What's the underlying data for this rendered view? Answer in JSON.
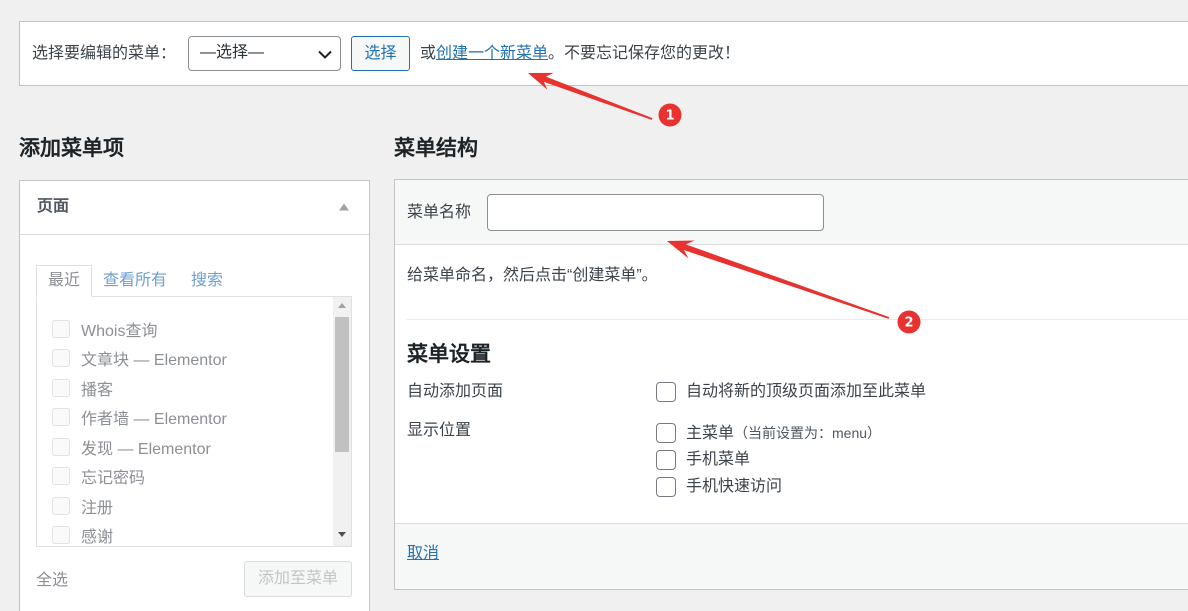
{
  "top_bar": {
    "label": "选择要编辑的菜单：",
    "select_value": "—选择—",
    "select_button": "选择",
    "or_text": "或",
    "create_link": "创建一个新菜单",
    "reminder": "。不要忘记保存您的更改！"
  },
  "add_items": {
    "heading": "添加菜单项",
    "disabled": true,
    "panel_title": "页面",
    "tabs": [
      {
        "label": "最近",
        "active": true
      },
      {
        "label": "查看所有",
        "active": false
      },
      {
        "label": "搜索",
        "active": false
      }
    ],
    "pages": [
      "Whois查询",
      "文章块 — Elementor",
      "播客",
      "作者墙 — Elementor",
      "发现 — Elementor",
      "忘记密码",
      "注册",
      "感谢"
    ],
    "select_all": "全选",
    "add_button": "添加至菜单"
  },
  "structure": {
    "heading": "菜单结构",
    "name_label": "菜单名称",
    "name_value": "",
    "hint": "给菜单命名，然后点击“创建菜单”。",
    "settings_heading": "菜单设置",
    "auto_add": {
      "label": "自动添加页面",
      "option": "自动将新的顶级页面添加至此菜单",
      "checked": false
    },
    "locations": {
      "label": "显示位置",
      "items": [
        {
          "label": "主菜单",
          "note": "（当前设置为：menu）",
          "checked": false
        },
        {
          "label": "手机菜单",
          "checked": false
        },
        {
          "label": "手机快速访问",
          "checked": false
        }
      ]
    },
    "cancel": "取消"
  },
  "annotations": [
    {
      "number": "1"
    },
    {
      "number": "2"
    }
  ],
  "icons": {
    "select_chevron": "chevron-down-icon",
    "panel_collapse": "triangle-up-icon",
    "scroll_up": "scroll-up-arrow-icon",
    "scroll_down": "scroll-down-arrow-icon"
  },
  "colors": {
    "accent": "#2271b1",
    "annotation": "#e8322f",
    "page_background": "#f0f0f1"
  }
}
